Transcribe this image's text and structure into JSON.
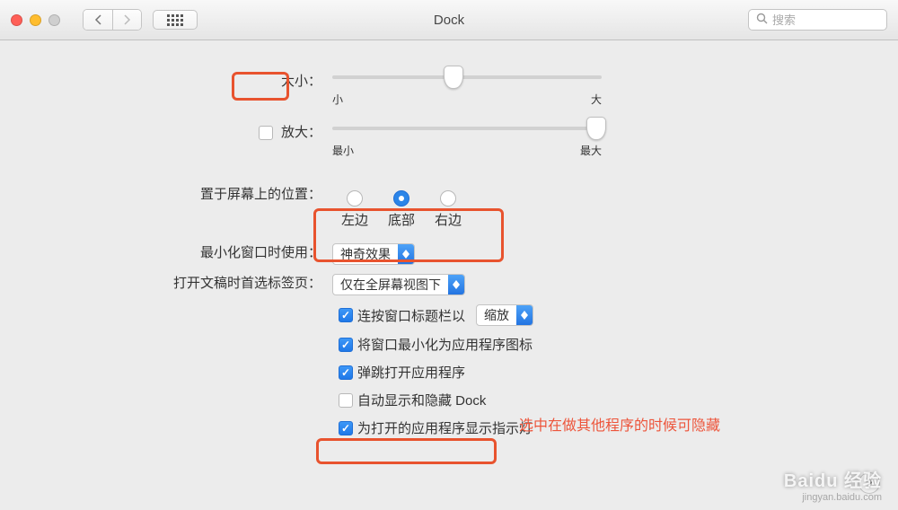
{
  "titlebar": {
    "title": "Dock",
    "search_placeholder": "搜索"
  },
  "size": {
    "label": "大小：",
    "min_label": "小",
    "max_label": "大",
    "value_pct": 45
  },
  "magnify": {
    "label": "放大：",
    "checked": false,
    "min_label": "最小",
    "max_label": "最大",
    "value_pct": 98
  },
  "position": {
    "label": "置于屏幕上的位置：",
    "options": [
      "左边",
      "底部",
      "右边"
    ],
    "selected_index": 1
  },
  "minimize_effect": {
    "label": "最小化窗口时使用：",
    "value": "神奇效果"
  },
  "prefer_tabs": {
    "label": "打开文稿时首选标签页：",
    "value": "仅在全屏幕视图下"
  },
  "checkboxes": {
    "doubleclick": {
      "checked": true,
      "text": "连按窗口标题栏以",
      "select": "缩放"
    },
    "minimize_into": {
      "checked": true,
      "text": "将窗口最小化为应用程序图标"
    },
    "animate_open": {
      "checked": true,
      "text": "弹跳打开应用程序"
    },
    "auto_hide": {
      "checked": false,
      "text": "自动显示和隐藏 Dock"
    },
    "indicators": {
      "checked": true,
      "text": "为打开的应用程序显示指示灯"
    }
  },
  "annotation": "选中在做其他程序的时候可隐藏",
  "watermark": {
    "main": "Baidu 经验",
    "sub": "jingyan.baidu.com"
  },
  "help": "?"
}
